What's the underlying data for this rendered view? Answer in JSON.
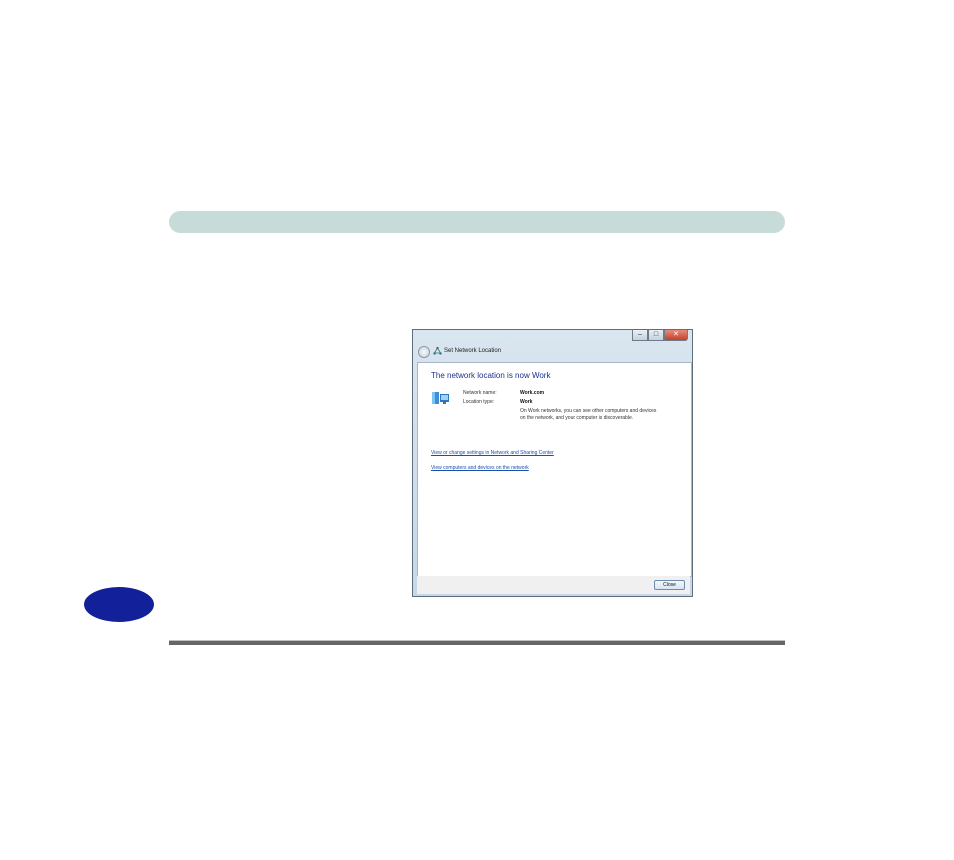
{
  "dialog": {
    "nav_title": "Set Network Location",
    "heading": "The network location is now Work",
    "network_name_label": "Network name:",
    "network_name_value": "Work.com",
    "location_type_label": "Location type:",
    "location_type_value": "Work",
    "description": "On Work networks, you can see other computers and devices on the network, and your computer is discoverable.",
    "link_settings": "View or change settings in Network and Sharing Center",
    "link_devices": "View computers and devices on the network",
    "close_label": "Close"
  },
  "icons": {
    "back": "back-arrow-icon",
    "nav": "network-icon",
    "location": "work-network-icon",
    "minimize": "minimize-icon",
    "maximize": "maximize-icon",
    "close": "close-icon"
  },
  "colors": {
    "top_bar": "#c7dcd8",
    "chapter_oval": "#12219a",
    "heading": "#1e3287",
    "link": "#1a4fae"
  }
}
